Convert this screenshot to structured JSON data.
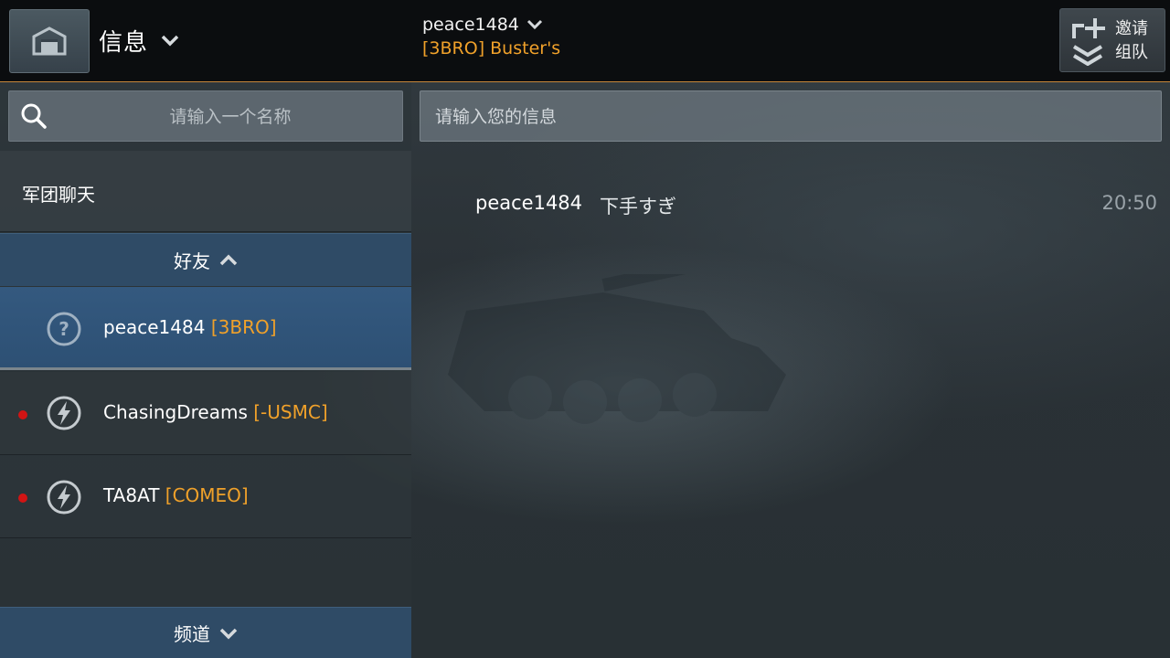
{
  "header": {
    "title": "信息",
    "chat_user": "peace1484",
    "chat_clan_name": "[3BRO] Buster's",
    "invite_line1": "邀请",
    "invite_line2": "组队"
  },
  "sidebar": {
    "search_placeholder": "请输入一个名称",
    "clan_chat_label": "军团聊天",
    "friends_header": "好友",
    "channels_header": "频道",
    "friends": [
      {
        "name": "peace1484",
        "clan": "[3BRO]",
        "status": "unknown",
        "status_icon": "question-icon",
        "selected": true
      },
      {
        "name": "ChasingDreams",
        "clan": "[-USMC]",
        "status": "in-battle",
        "status_icon": "lightning-icon",
        "selected": false
      },
      {
        "name": "TA8AT",
        "clan": "[COMEO]",
        "status": "in-battle",
        "status_icon": "lightning-icon",
        "selected": false
      }
    ]
  },
  "chat": {
    "input_placeholder": "请输入您的信息",
    "messages": [
      {
        "sender": "peace1484",
        "text": "下手すぎ",
        "time": "20:50"
      }
    ]
  },
  "colors": {
    "clan_tag": "#f0a12a",
    "selected_row": "#34597f",
    "section_header": "#2f4b66",
    "status_dot": "#d21414",
    "topbar_border": "#c7873a"
  }
}
